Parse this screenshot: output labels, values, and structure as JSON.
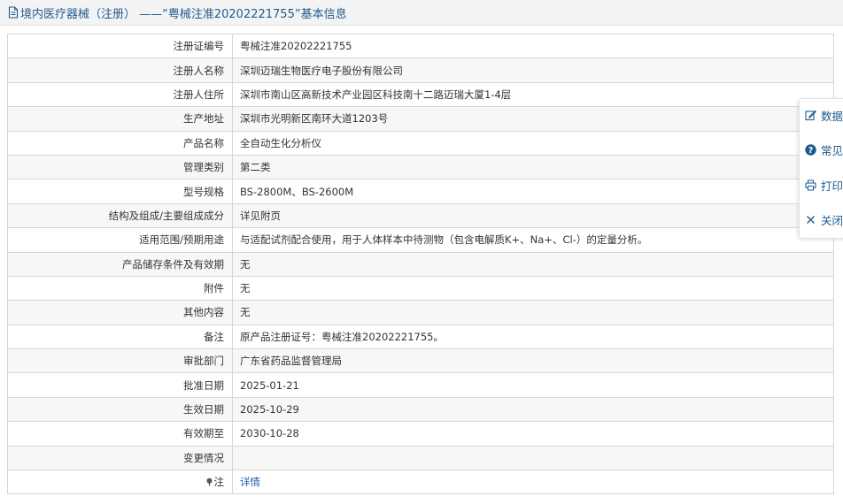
{
  "header": {
    "title": "境内医疗器械（注册） ——“粤械注准20202221755”基本信息"
  },
  "rows": [
    {
      "label": "注册证编号",
      "value": "粤械注准20202221755"
    },
    {
      "label": "注册人名称",
      "value": "深圳迈瑞生物医疗电子股份有限公司"
    },
    {
      "label": "注册人住所",
      "value": "深圳市南山区高新技术产业园区科技南十二路迈瑞大厦1-4层"
    },
    {
      "label": "生产地址",
      "value": "深圳市光明新区南环大道1203号"
    },
    {
      "label": "产品名称",
      "value": "全自动生化分析仪"
    },
    {
      "label": "管理类别",
      "value": "第二类"
    },
    {
      "label": "型号规格",
      "value": "BS-2800M、BS-2600M"
    },
    {
      "label": "结构及组成/主要组成成分",
      "value": "详见附页"
    },
    {
      "label": "适用范围/预期用途",
      "value": "与适配试剂配合使用，用于人体样本中待测物（包含电解质K+、Na+、Cl-）的定量分析。"
    },
    {
      "label": "产品储存条件及有效期",
      "value": "无"
    },
    {
      "label": "附件",
      "value": "无"
    },
    {
      "label": "其他内容",
      "value": "无"
    },
    {
      "label": "备注",
      "value": "原产品注册证号：粤械注准20202221755。"
    },
    {
      "label": "审批部门",
      "value": "广东省药品监督管理局"
    },
    {
      "label": "批准日期",
      "value": "2025-01-21"
    },
    {
      "label": "生效日期",
      "value": "2025-10-29"
    },
    {
      "label": "有效期至",
      "value": "2030-10-28"
    },
    {
      "label": "变更情况",
      "value": ""
    },
    {
      "label": "注",
      "value": "详情"
    }
  ],
  "float_panel": {
    "items": [
      {
        "label": "数据",
        "icon": "edit-icon"
      },
      {
        "label": "常见",
        "icon": "help-icon"
      },
      {
        "label": "打印",
        "icon": "print-icon"
      },
      {
        "label": "关闭",
        "icon": "close-icon"
      }
    ]
  },
  "colors": {
    "link": "#1d5fb0",
    "header_text": "#1f5a8f",
    "help_icon_bg": "#1f5a8f"
  }
}
